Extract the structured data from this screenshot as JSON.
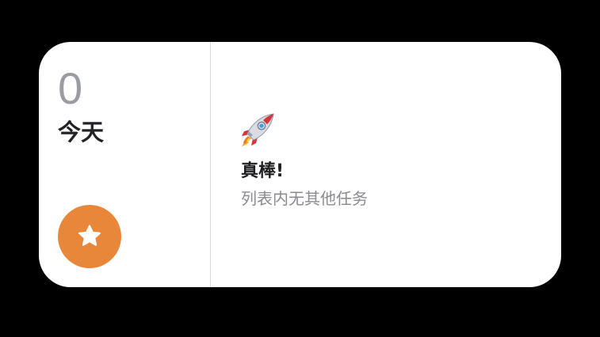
{
  "widget": {
    "count": "0",
    "list_title": "今天",
    "star_button_icon": "star-icon",
    "accent_color": "#e8863a",
    "empty_state": {
      "icon": "rocket-icon",
      "title": "真棒!",
      "subtitle": "列表内无其他任务"
    }
  }
}
